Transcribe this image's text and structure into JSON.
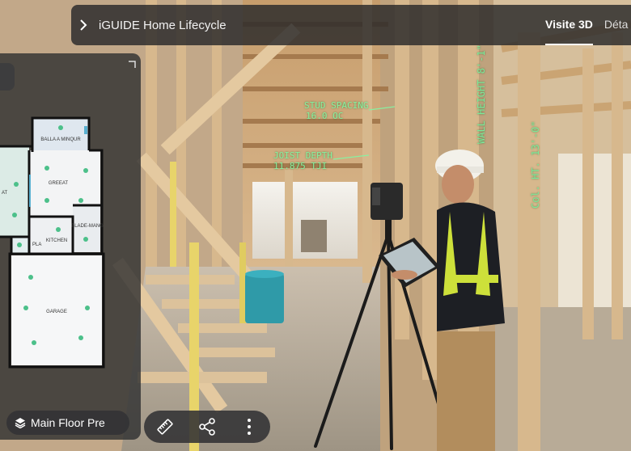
{
  "header": {
    "title": "iGUIDE Home Lifecycle",
    "tabs": [
      {
        "label": "Visite 3D",
        "active": true
      },
      {
        "label": "Déta",
        "active": false
      }
    ]
  },
  "floorplan": {
    "rooms": {
      "balla": "BALLA A MINQUR",
      "greeat": "GREEAT",
      "at": "AT",
      "kitchen": "KITCHEN",
      "blade": "BLADE-MANG",
      "pla": "PLA",
      "garage": "GARAGE"
    },
    "floor_label": "Main Floor Pre"
  },
  "annotations": {
    "stud_line1": "STUD SPACING",
    "stud_line2": "16.0 OC",
    "joist_line1": "JOIST DEPTH",
    "joist_line2": "11.875 TJI",
    "wall_height": "WALL HEIGHT 8'-1\"",
    "col_height": "Col. HT. 13'-0\""
  },
  "icons": [
    "chevron-right-icon",
    "layers-icon",
    "ruler-icon",
    "share-icon",
    "more-vertical-icon",
    "expand-corner-icon"
  ],
  "colors": {
    "annotation": "#8af0a0",
    "panel": "#2d2e30",
    "marker": "#4cc08a"
  }
}
